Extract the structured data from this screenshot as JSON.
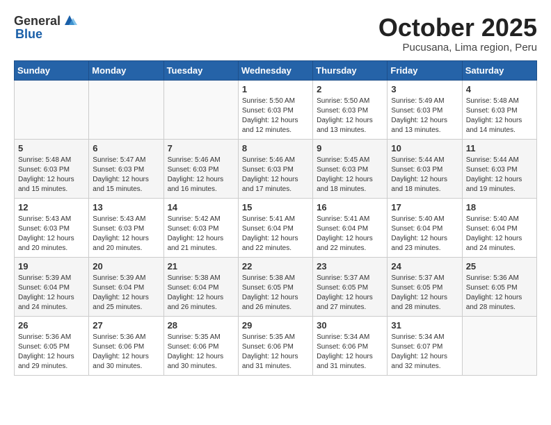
{
  "header": {
    "logo": {
      "text_general": "General",
      "text_blue": "Blue"
    },
    "month": "October 2025",
    "location": "Pucusana, Lima region, Peru"
  },
  "weekdays": [
    "Sunday",
    "Monday",
    "Tuesday",
    "Wednesday",
    "Thursday",
    "Friday",
    "Saturday"
  ],
  "weeks": [
    [
      {
        "day": "",
        "info": ""
      },
      {
        "day": "",
        "info": ""
      },
      {
        "day": "",
        "info": ""
      },
      {
        "day": "1",
        "info": "Sunrise: 5:50 AM\nSunset: 6:03 PM\nDaylight: 12 hours\nand 12 minutes."
      },
      {
        "day": "2",
        "info": "Sunrise: 5:50 AM\nSunset: 6:03 PM\nDaylight: 12 hours\nand 13 minutes."
      },
      {
        "day": "3",
        "info": "Sunrise: 5:49 AM\nSunset: 6:03 PM\nDaylight: 12 hours\nand 13 minutes."
      },
      {
        "day": "4",
        "info": "Sunrise: 5:48 AM\nSunset: 6:03 PM\nDaylight: 12 hours\nand 14 minutes."
      }
    ],
    [
      {
        "day": "5",
        "info": "Sunrise: 5:48 AM\nSunset: 6:03 PM\nDaylight: 12 hours\nand 15 minutes."
      },
      {
        "day": "6",
        "info": "Sunrise: 5:47 AM\nSunset: 6:03 PM\nDaylight: 12 hours\nand 15 minutes."
      },
      {
        "day": "7",
        "info": "Sunrise: 5:46 AM\nSunset: 6:03 PM\nDaylight: 12 hours\nand 16 minutes."
      },
      {
        "day": "8",
        "info": "Sunrise: 5:46 AM\nSunset: 6:03 PM\nDaylight: 12 hours\nand 17 minutes."
      },
      {
        "day": "9",
        "info": "Sunrise: 5:45 AM\nSunset: 6:03 PM\nDaylight: 12 hours\nand 18 minutes."
      },
      {
        "day": "10",
        "info": "Sunrise: 5:44 AM\nSunset: 6:03 PM\nDaylight: 12 hours\nand 18 minutes."
      },
      {
        "day": "11",
        "info": "Sunrise: 5:44 AM\nSunset: 6:03 PM\nDaylight: 12 hours\nand 19 minutes."
      }
    ],
    [
      {
        "day": "12",
        "info": "Sunrise: 5:43 AM\nSunset: 6:03 PM\nDaylight: 12 hours\nand 20 minutes."
      },
      {
        "day": "13",
        "info": "Sunrise: 5:43 AM\nSunset: 6:03 PM\nDaylight: 12 hours\nand 20 minutes."
      },
      {
        "day": "14",
        "info": "Sunrise: 5:42 AM\nSunset: 6:03 PM\nDaylight: 12 hours\nand 21 minutes."
      },
      {
        "day": "15",
        "info": "Sunrise: 5:41 AM\nSunset: 6:04 PM\nDaylight: 12 hours\nand 22 minutes."
      },
      {
        "day": "16",
        "info": "Sunrise: 5:41 AM\nSunset: 6:04 PM\nDaylight: 12 hours\nand 22 minutes."
      },
      {
        "day": "17",
        "info": "Sunrise: 5:40 AM\nSunset: 6:04 PM\nDaylight: 12 hours\nand 23 minutes."
      },
      {
        "day": "18",
        "info": "Sunrise: 5:40 AM\nSunset: 6:04 PM\nDaylight: 12 hours\nand 24 minutes."
      }
    ],
    [
      {
        "day": "19",
        "info": "Sunrise: 5:39 AM\nSunset: 6:04 PM\nDaylight: 12 hours\nand 24 minutes."
      },
      {
        "day": "20",
        "info": "Sunrise: 5:39 AM\nSunset: 6:04 PM\nDaylight: 12 hours\nand 25 minutes."
      },
      {
        "day": "21",
        "info": "Sunrise: 5:38 AM\nSunset: 6:04 PM\nDaylight: 12 hours\nand 26 minutes."
      },
      {
        "day": "22",
        "info": "Sunrise: 5:38 AM\nSunset: 6:05 PM\nDaylight: 12 hours\nand 26 minutes."
      },
      {
        "day": "23",
        "info": "Sunrise: 5:37 AM\nSunset: 6:05 PM\nDaylight: 12 hours\nand 27 minutes."
      },
      {
        "day": "24",
        "info": "Sunrise: 5:37 AM\nSunset: 6:05 PM\nDaylight: 12 hours\nand 28 minutes."
      },
      {
        "day": "25",
        "info": "Sunrise: 5:36 AM\nSunset: 6:05 PM\nDaylight: 12 hours\nand 28 minutes."
      }
    ],
    [
      {
        "day": "26",
        "info": "Sunrise: 5:36 AM\nSunset: 6:05 PM\nDaylight: 12 hours\nand 29 minutes."
      },
      {
        "day": "27",
        "info": "Sunrise: 5:36 AM\nSunset: 6:06 PM\nDaylight: 12 hours\nand 30 minutes."
      },
      {
        "day": "28",
        "info": "Sunrise: 5:35 AM\nSunset: 6:06 PM\nDaylight: 12 hours\nand 30 minutes."
      },
      {
        "day": "29",
        "info": "Sunrise: 5:35 AM\nSunset: 6:06 PM\nDaylight: 12 hours\nand 31 minutes."
      },
      {
        "day": "30",
        "info": "Sunrise: 5:34 AM\nSunset: 6:06 PM\nDaylight: 12 hours\nand 31 minutes."
      },
      {
        "day": "31",
        "info": "Sunrise: 5:34 AM\nSunset: 6:07 PM\nDaylight: 12 hours\nand 32 minutes."
      },
      {
        "day": "",
        "info": ""
      }
    ]
  ]
}
